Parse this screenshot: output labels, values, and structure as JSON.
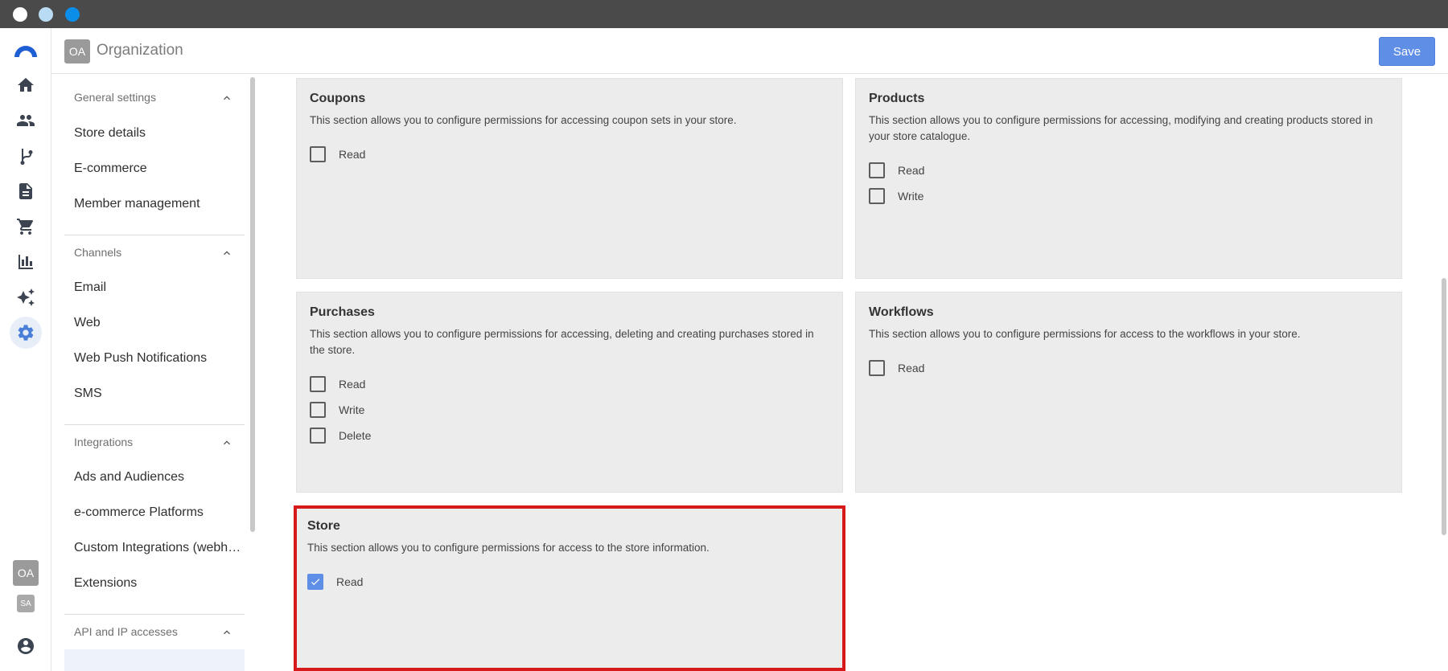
{
  "header": {
    "org_badge": "OA",
    "org_title": "Organization",
    "save_label": "Save"
  },
  "rail": {
    "items": [
      "logo-icon",
      "home-icon",
      "people-icon",
      "branch-icon",
      "document-icon",
      "cart-icon",
      "chart-icon",
      "sparkle-icon",
      "gear-icon"
    ],
    "active": "gear-icon",
    "workspace_badges": [
      "OA",
      "SA"
    ],
    "bottom": "account-icon"
  },
  "sidebar": {
    "groups": [
      {
        "title": "General settings",
        "items": [
          "Store details",
          "E-commerce",
          "Member management"
        ]
      },
      {
        "title": "Channels",
        "items": [
          "Email",
          "Web",
          "Web Push Notifications",
          "SMS"
        ]
      },
      {
        "title": "Integrations",
        "items": [
          "Ads and Audiences",
          "e-commerce Platforms",
          "Custom Integrations (webhooks)",
          "Extensions"
        ]
      },
      {
        "title": "API and IP accesses",
        "items": []
      }
    ]
  },
  "cards": [
    {
      "title": "Coupons",
      "desc": "This section allows you to configure permissions for accessing coupon sets in your store.",
      "perms": [
        {
          "label": "Read",
          "checked": false
        }
      ]
    },
    {
      "title": "Products",
      "desc": "This section allows you to configure permissions for accessing, modifying and creating products stored in your store catalogue.",
      "perms": [
        {
          "label": "Read",
          "checked": false
        },
        {
          "label": "Write",
          "checked": false
        }
      ]
    },
    {
      "title": "Purchases",
      "desc": "This section allows you to configure permissions for accessing, deleting and creating purchases stored in the store.",
      "perms": [
        {
          "label": "Read",
          "checked": false
        },
        {
          "label": "Write",
          "checked": false
        },
        {
          "label": "Delete",
          "checked": false
        }
      ]
    },
    {
      "title": "Workflows",
      "desc": "This section allows you to configure permissions for access to the workflows in your store.",
      "perms": [
        {
          "label": "Read",
          "checked": false
        }
      ]
    },
    {
      "title": "Store",
      "desc": "This section allows you to configure permissions for access to the store information.",
      "perms": [
        {
          "label": "Read",
          "checked": true
        }
      ]
    }
  ],
  "colors": {
    "accent": "#5f8ee6",
    "highlight": "#d61a1a",
    "card_bg": "#ececec"
  }
}
